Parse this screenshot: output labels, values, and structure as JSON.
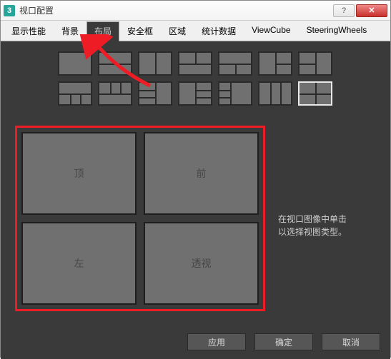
{
  "window": {
    "app_icon_text": "3",
    "title": "视口配置",
    "help_btn": "?",
    "close_btn": "✕"
  },
  "tabs": [
    {
      "label": "显示性能"
    },
    {
      "label": "背景"
    },
    {
      "label": "布局"
    },
    {
      "label": "安全框"
    },
    {
      "label": "区域"
    },
    {
      "label": "统计数据"
    },
    {
      "label": "ViewCube"
    },
    {
      "label": "SteeringWheels"
    }
  ],
  "active_tab_index": 2,
  "layout_thumbs": {
    "rows": 2,
    "cols": 7,
    "selected_index": 13
  },
  "preview": {
    "cells": [
      {
        "label": "顶"
      },
      {
        "label": "前"
      },
      {
        "label": "左"
      },
      {
        "label": "透视"
      }
    ]
  },
  "help_text_line1": "在视口图像中单击",
  "help_text_line2": "以选择视图类型。",
  "buttons": {
    "apply": "应用",
    "ok": "确定",
    "cancel": "取消"
  },
  "colors": {
    "highlight": "#ee1c25",
    "panel_bg": "#3a3a3a",
    "cell_bg": "#707070"
  }
}
